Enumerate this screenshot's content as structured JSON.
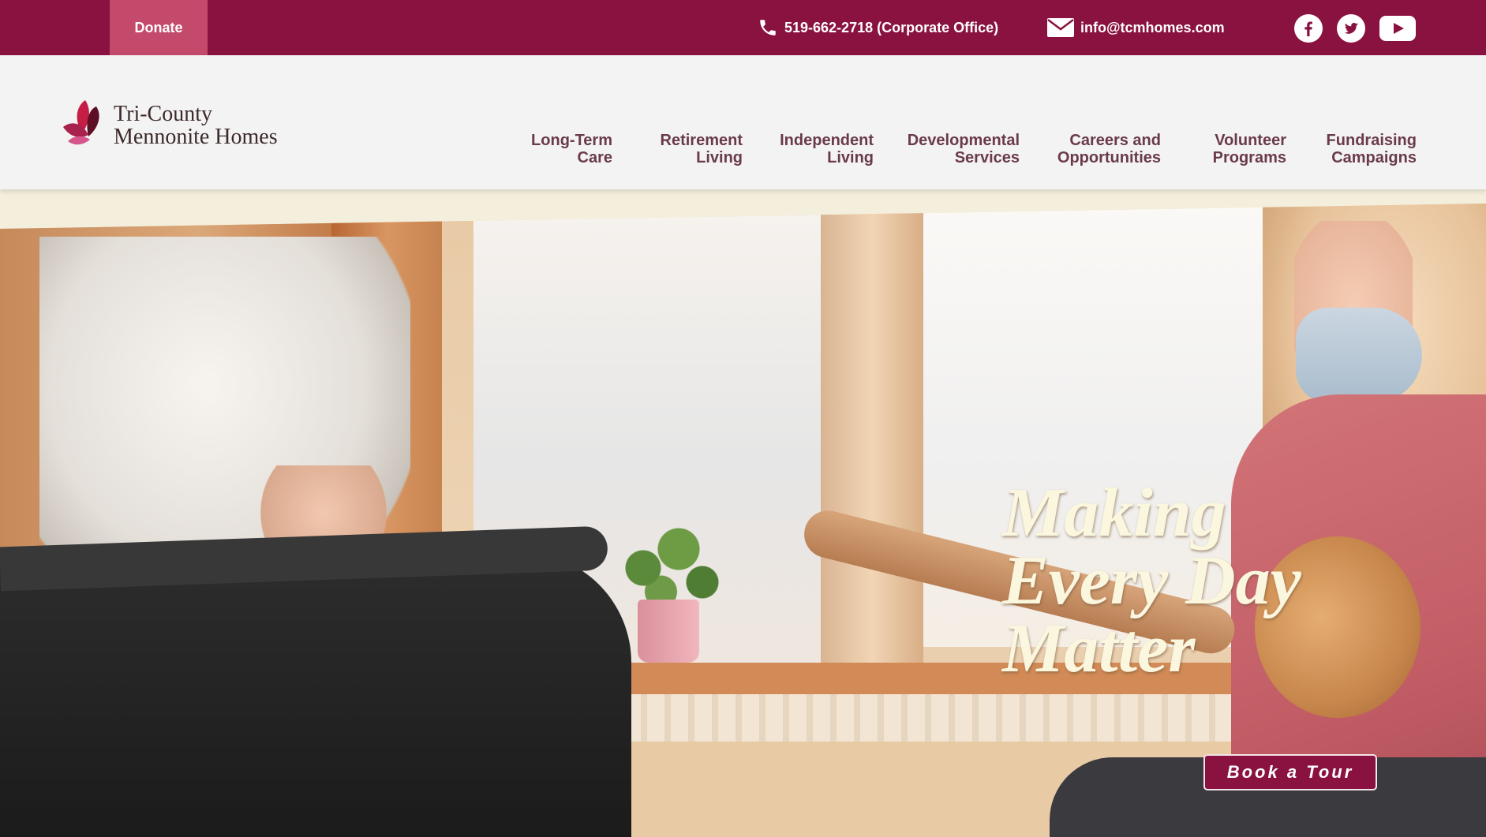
{
  "topbar": {
    "donate_label": "Donate",
    "phone": "519-662-2718 (Corporate Office)",
    "email": "info@tcmhomes.com",
    "phone_icon": "phone-icon",
    "email_icon": "envelope-icon",
    "social": [
      "facebook-icon",
      "twitter-icon",
      "youtube-icon"
    ]
  },
  "header": {
    "logo_line1": "Tri-County",
    "logo_line2": "Mennonite Homes",
    "nav": [
      {
        "line1": "Long-Term",
        "line2": "Care"
      },
      {
        "line1": "Retirement",
        "line2": "Living"
      },
      {
        "line1": "Independent",
        "line2": "Living"
      },
      {
        "line1": "Developmental",
        "line2": "Services"
      },
      {
        "line1": "Careers and",
        "line2": "Opportunities"
      },
      {
        "line1": "Volunteer",
        "line2": "Programs"
      },
      {
        "line1": "Fundraising",
        "line2": "Campaigns"
      }
    ]
  },
  "hero": {
    "tagline_line1": "Making",
    "tagline_line2": "Every Day",
    "tagline_line3": "Matter",
    "cta_label": "Book a Tour"
  },
  "colors": {
    "brand": "#8a1240",
    "donate_bg": "#c44a6c",
    "nav_text": "#6a3a4a",
    "tagline": "#fbf6de"
  }
}
